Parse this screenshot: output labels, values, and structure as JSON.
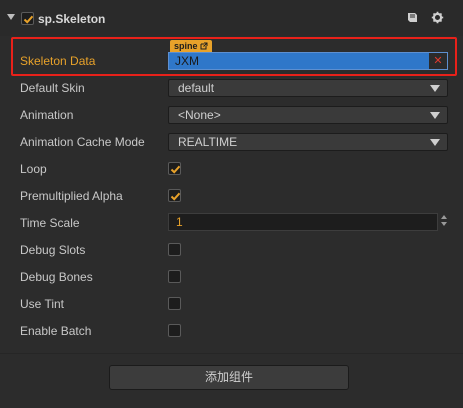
{
  "header": {
    "title": "sp.Skeleton",
    "enabled": true
  },
  "properties": {
    "skeleton_data": {
      "label": "Skeleton Data",
      "tag": "spine",
      "value": "JXM"
    },
    "default_skin": {
      "label": "Default Skin",
      "value": "default"
    },
    "animation": {
      "label": "Animation",
      "value": "<None>"
    },
    "animation_cache_mode": {
      "label": "Animation Cache Mode",
      "value": "REALTIME"
    },
    "loop": {
      "label": "Loop",
      "checked": true
    },
    "premultiplied_alpha": {
      "label": "Premultiplied Alpha",
      "checked": true
    },
    "time_scale": {
      "label": "Time Scale",
      "value": "1"
    },
    "debug_slots": {
      "label": "Debug Slots",
      "checked": false
    },
    "debug_bones": {
      "label": "Debug Bones",
      "checked": false
    },
    "use_tint": {
      "label": "Use Tint",
      "checked": false
    },
    "enable_batch": {
      "label": "Enable Batch",
      "checked": false
    }
  },
  "add_component_label": "添加组件",
  "colors": {
    "accent": "#e8a22a",
    "highlight": "#e8211a",
    "selection": "#2f77c9"
  },
  "icons": {
    "collapse": "triangle-down-icon",
    "docs": "book-icon",
    "settings": "gear-icon",
    "clear": "x-icon",
    "link": "external-link-icon"
  }
}
